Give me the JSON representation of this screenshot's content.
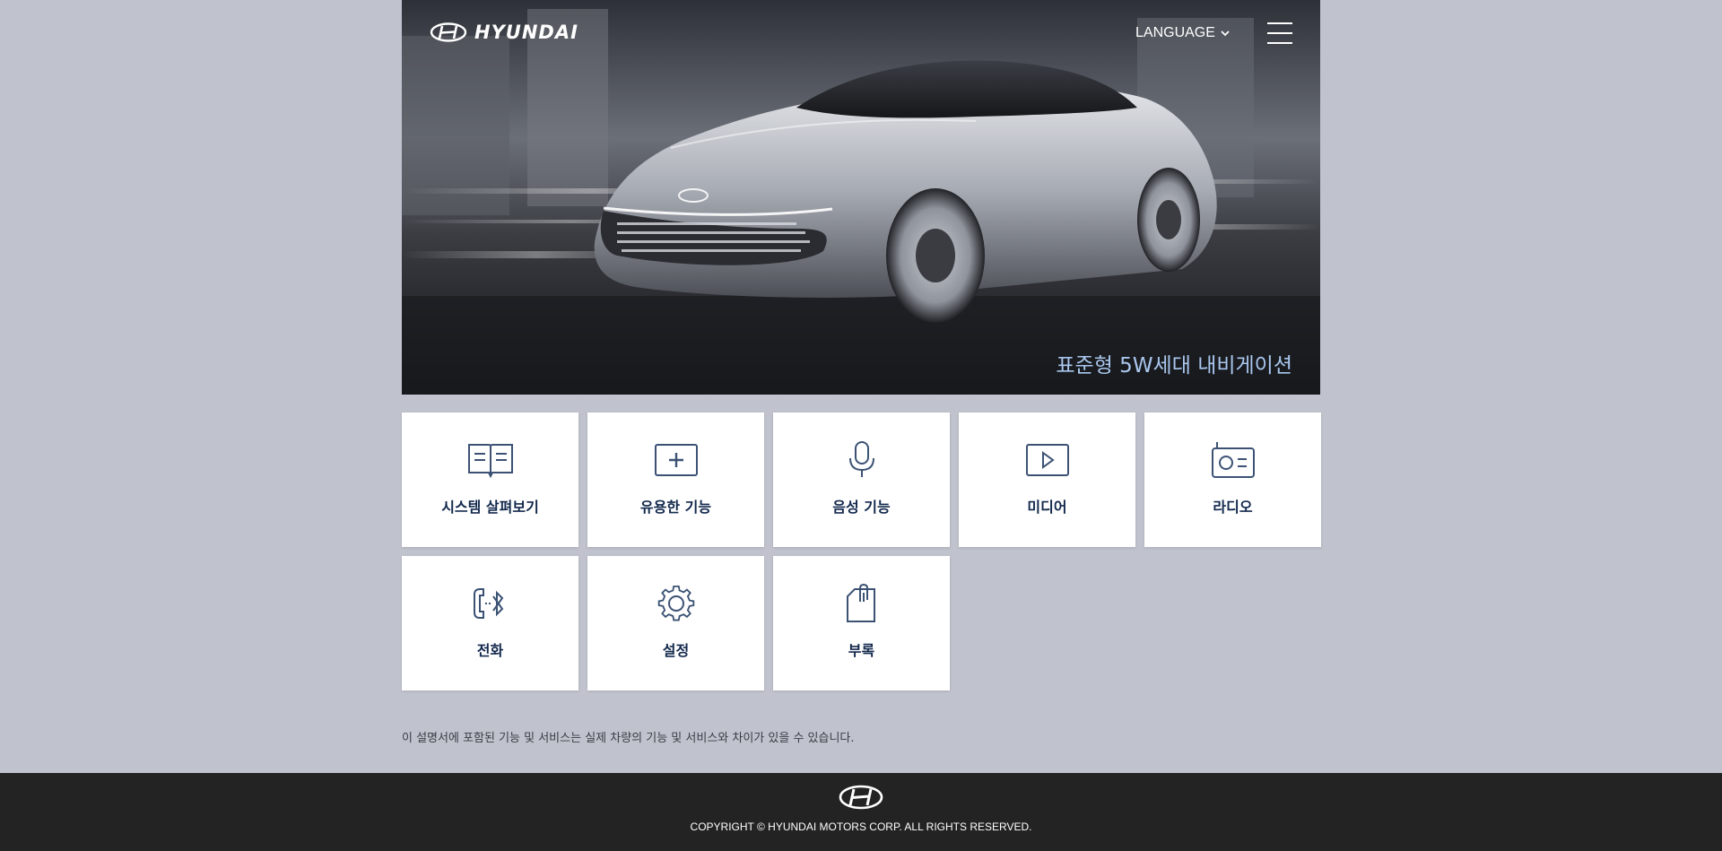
{
  "header": {
    "brand": "HYUNDAI",
    "language_label": "LANGUAGE"
  },
  "hero": {
    "title": "표준형 5W세대 내비게이션"
  },
  "tiles": [
    {
      "label": "시스템 살펴보기",
      "icon": "book-icon"
    },
    {
      "label": "유용한 기능",
      "icon": "plus-box-icon"
    },
    {
      "label": "음성 기능",
      "icon": "microphone-icon"
    },
    {
      "label": "미디어",
      "icon": "play-box-icon"
    },
    {
      "label": "라디오",
      "icon": "radio-icon"
    },
    {
      "label": "전화",
      "icon": "bluetooth-phone-icon"
    },
    {
      "label": "설정",
      "icon": "gear-icon"
    },
    {
      "label": "부록",
      "icon": "clipped-document-icon"
    }
  ],
  "disclaimer": "이 설명서에 포함된 기능 및 서비스는 실제 차량의 기능 및 서비스와 차이가 있을 수 있습니다.",
  "footer": {
    "copyright": "COPYRIGHT © HYUNDAI MOTORS CORP. ALL RIGHTS RESERVED."
  },
  "colors": {
    "page_bg": "#c0c3cd",
    "tile_label": "#12284c",
    "hero_title": "#a9c7ee",
    "footer_bg": "#232323"
  }
}
